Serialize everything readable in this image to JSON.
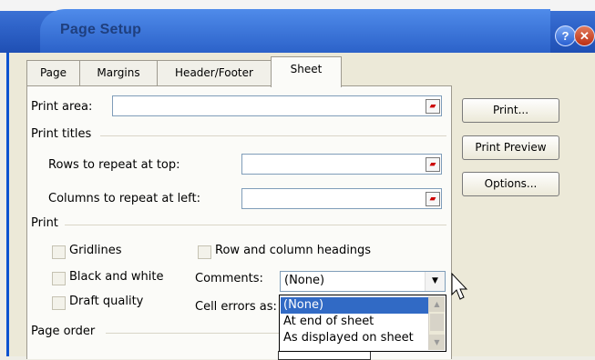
{
  "window": {
    "title": "Page Setup",
    "help_button": "?",
    "close_button": "✕"
  },
  "tabs": [
    {
      "label": "Page"
    },
    {
      "label": "Margins"
    },
    {
      "label": "Header/Footer"
    },
    {
      "label": "Sheet",
      "active": true
    }
  ],
  "sheet": {
    "print_area_label": "Print area:",
    "print_titles_label": "Print titles",
    "rows_label": "Rows to repeat at top:",
    "columns_label": "Columns to repeat at left:",
    "print_label": "Print",
    "gridlines_label": "Gridlines",
    "black_white_label": "Black and white",
    "draft_quality_label": "Draft quality",
    "row_col_headings_label": "Row and column headings",
    "comments_label": "Comments:",
    "comments_value": "(None)",
    "cell_errors_label": "Cell errors as:",
    "page_order_label": "Page order",
    "comments_options": [
      "(None)",
      "At end of sheet",
      "As displayed on sheet"
    ]
  },
  "side_buttons": {
    "print": "Print...",
    "print_preview": "Print Preview",
    "options": "Options..."
  }
}
